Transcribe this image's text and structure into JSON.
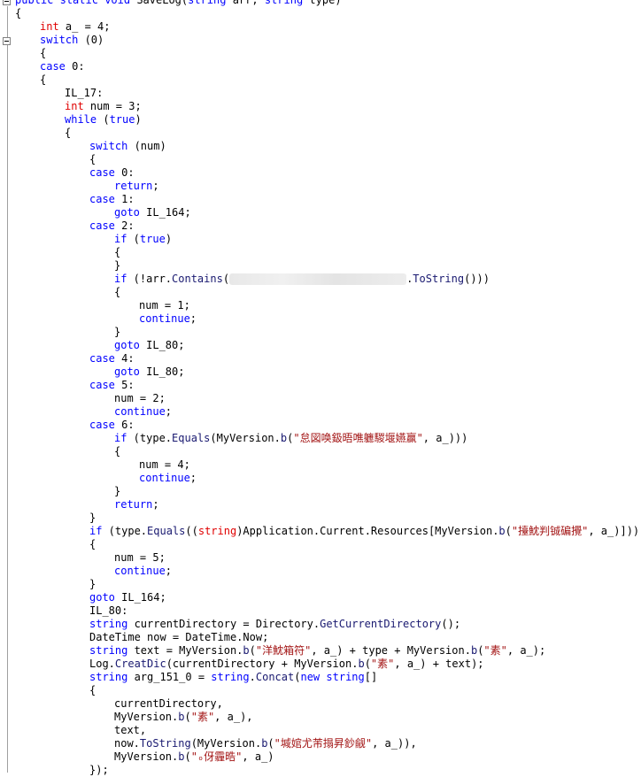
{
  "lines": [
    {
      "indent": 0,
      "parts": [
        [
          "kw",
          "public"
        ],
        [
          "t",
          " "
        ],
        [
          "kw",
          "static"
        ],
        [
          "t",
          " "
        ],
        [
          "kw",
          "void"
        ],
        [
          "t",
          " SaveLog("
        ],
        [
          "kw",
          "string"
        ],
        [
          "t",
          " arr, "
        ],
        [
          "kw",
          "string"
        ],
        [
          "t",
          " type)"
        ]
      ]
    },
    {
      "indent": 0,
      "parts": [
        [
          "t",
          "{"
        ]
      ]
    },
    {
      "indent": 1,
      "parts": [
        [
          "kw2",
          "int"
        ],
        [
          "t",
          " a_ = 4;"
        ]
      ]
    },
    {
      "indent": 1,
      "parts": [
        [
          "kw",
          "switch"
        ],
        [
          "t",
          " (0)"
        ]
      ]
    },
    {
      "indent": 1,
      "parts": [
        [
          "t",
          "{"
        ]
      ]
    },
    {
      "indent": 1,
      "parts": [
        [
          "kw",
          "case"
        ],
        [
          "t",
          " 0:"
        ]
      ]
    },
    {
      "indent": 1,
      "parts": [
        [
          "t",
          "{"
        ]
      ]
    },
    {
      "indent": 2,
      "parts": [
        [
          "t",
          "IL_17:"
        ]
      ]
    },
    {
      "indent": 2,
      "parts": [
        [
          "kw2",
          "int"
        ],
        [
          "t",
          " num = 3;"
        ]
      ]
    },
    {
      "indent": 2,
      "parts": [
        [
          "kw",
          "while"
        ],
        [
          "t",
          " ("
        ],
        [
          "bool",
          "true"
        ],
        [
          "t",
          ")"
        ]
      ]
    },
    {
      "indent": 2,
      "parts": [
        [
          "t",
          "{"
        ]
      ]
    },
    {
      "indent": 3,
      "parts": [
        [
          "kw",
          "switch"
        ],
        [
          "t",
          " (num)"
        ]
      ]
    },
    {
      "indent": 3,
      "parts": [
        [
          "t",
          "{"
        ]
      ]
    },
    {
      "indent": 3,
      "parts": [
        [
          "kw",
          "case"
        ],
        [
          "t",
          " 0:"
        ]
      ]
    },
    {
      "indent": 4,
      "parts": [
        [
          "kw",
          "return"
        ],
        [
          "t",
          ";"
        ]
      ]
    },
    {
      "indent": 3,
      "parts": [
        [
          "kw",
          "case"
        ],
        [
          "t",
          " 1:"
        ]
      ]
    },
    {
      "indent": 4,
      "parts": [
        [
          "kw",
          "goto"
        ],
        [
          "t",
          " IL_164;"
        ]
      ]
    },
    {
      "indent": 3,
      "parts": [
        [
          "kw",
          "case"
        ],
        [
          "t",
          " 2:"
        ]
      ]
    },
    {
      "indent": 4,
      "parts": [
        [
          "kw",
          "if"
        ],
        [
          "t",
          " ("
        ],
        [
          "bool",
          "true"
        ],
        [
          "t",
          ")"
        ]
      ]
    },
    {
      "indent": 4,
      "parts": [
        [
          "t",
          "{"
        ]
      ]
    },
    {
      "indent": 4,
      "parts": [
        [
          "t",
          "}"
        ]
      ]
    },
    {
      "indent": 4,
      "parts": [
        [
          "kw",
          "if"
        ],
        [
          "t",
          " (!arr."
        ],
        [
          "method",
          "Contains"
        ],
        [
          "t",
          "("
        ],
        [
          "blur",
          ""
        ],
        [
          "t",
          "."
        ],
        [
          "method",
          "ToString"
        ],
        [
          "t",
          "()))"
        ]
      ]
    },
    {
      "indent": 4,
      "parts": [
        [
          "t",
          "{"
        ]
      ]
    },
    {
      "indent": 5,
      "parts": [
        [
          "t",
          "num = 1;"
        ]
      ]
    },
    {
      "indent": 5,
      "parts": [
        [
          "kw",
          "continue"
        ],
        [
          "t",
          ";"
        ]
      ]
    },
    {
      "indent": 4,
      "parts": [
        [
          "t",
          "}"
        ]
      ]
    },
    {
      "indent": 4,
      "parts": [
        [
          "kw",
          "goto"
        ],
        [
          "t",
          " IL_80;"
        ]
      ]
    },
    {
      "indent": 3,
      "parts": [
        [
          "kw",
          "case"
        ],
        [
          "t",
          " 4:"
        ]
      ]
    },
    {
      "indent": 4,
      "parts": [
        [
          "kw",
          "goto"
        ],
        [
          "t",
          " IL_80;"
        ]
      ]
    },
    {
      "indent": 3,
      "parts": [
        [
          "kw",
          "case"
        ],
        [
          "t",
          " 5:"
        ]
      ]
    },
    {
      "indent": 4,
      "parts": [
        [
          "t",
          "num = 2;"
        ]
      ]
    },
    {
      "indent": 4,
      "parts": [
        [
          "kw",
          "continue"
        ],
        [
          "t",
          ";"
        ]
      ]
    },
    {
      "indent": 3,
      "parts": [
        [
          "kw",
          "case"
        ],
        [
          "t",
          " 6:"
        ]
      ]
    },
    {
      "indent": 4,
      "parts": [
        [
          "kw",
          "if"
        ],
        [
          "t",
          " (type."
        ],
        [
          "method",
          "Equals"
        ],
        [
          "t",
          "(MyVersion."
        ],
        [
          "method",
          "b"
        ],
        [
          "t",
          "("
        ],
        [
          "str",
          "\"怠図唤鈒晤噍軈騣堰嬿赢\""
        ],
        [
          "t",
          ", a_)))"
        ]
      ]
    },
    {
      "indent": 4,
      "parts": [
        [
          "t",
          "{"
        ]
      ]
    },
    {
      "indent": 5,
      "parts": [
        [
          "t",
          "num = 4;"
        ]
      ]
    },
    {
      "indent": 5,
      "parts": [
        [
          "kw",
          "continue"
        ],
        [
          "t",
          ";"
        ]
      ]
    },
    {
      "indent": 4,
      "parts": [
        [
          "t",
          "}"
        ]
      ]
    },
    {
      "indent": 4,
      "parts": [
        [
          "kw",
          "return"
        ],
        [
          "t",
          ";"
        ]
      ]
    },
    {
      "indent": 3,
      "parts": [
        [
          "t",
          "}"
        ]
      ]
    },
    {
      "indent": 3,
      "parts": [
        [
          "kw",
          "if"
        ],
        [
          "t",
          " (type."
        ],
        [
          "method",
          "Equals"
        ],
        [
          "t",
          "(("
        ],
        [
          "kw2",
          "string"
        ],
        [
          "t",
          ")Application.Current.Resources[MyVersion."
        ],
        [
          "method",
          "b"
        ],
        [
          "t",
          "("
        ],
        [
          "str",
          "\"擡魫判铖碥攪\""
        ],
        [
          "t",
          ", a_)]))"
        ]
      ]
    },
    {
      "indent": 3,
      "parts": [
        [
          "t",
          "{"
        ]
      ]
    },
    {
      "indent": 4,
      "parts": [
        [
          "t",
          "num = 5;"
        ]
      ]
    },
    {
      "indent": 4,
      "parts": [
        [
          "kw",
          "continue"
        ],
        [
          "t",
          ";"
        ]
      ]
    },
    {
      "indent": 3,
      "parts": [
        [
          "t",
          "}"
        ]
      ]
    },
    {
      "indent": 3,
      "parts": [
        [
          "kw",
          "goto"
        ],
        [
          "t",
          " IL_164;"
        ]
      ]
    },
    {
      "indent": 3,
      "parts": [
        [
          "t",
          "IL_80:"
        ]
      ]
    },
    {
      "indent": 3,
      "parts": [
        [
          "kw",
          "string"
        ],
        [
          "t",
          " currentDirectory = Directory."
        ],
        [
          "method",
          "GetCurrentDirectory"
        ],
        [
          "t",
          "();"
        ]
      ]
    },
    {
      "indent": 3,
      "parts": [
        [
          "t",
          "DateTime now = DateTime.Now;"
        ]
      ]
    },
    {
      "indent": 3,
      "parts": [
        [
          "kw",
          "string"
        ],
        [
          "t",
          " text = MyVersion."
        ],
        [
          "method",
          "b"
        ],
        [
          "t",
          "("
        ],
        [
          "str",
          "\"洋魫箱符\""
        ],
        [
          "t",
          ", a_) + type + MyVersion."
        ],
        [
          "method",
          "b"
        ],
        [
          "t",
          "("
        ],
        [
          "str",
          "\"素\""
        ],
        [
          "t",
          ", a_);"
        ]
      ]
    },
    {
      "indent": 3,
      "parts": [
        [
          "t",
          "Log."
        ],
        [
          "method",
          "CreatDic"
        ],
        [
          "t",
          "(currentDirectory + MyVersion."
        ],
        [
          "method",
          "b"
        ],
        [
          "t",
          "("
        ],
        [
          "str",
          "\"素\""
        ],
        [
          "t",
          ", a_) + text);"
        ]
      ]
    },
    {
      "indent": 3,
      "parts": [
        [
          "kw",
          "string"
        ],
        [
          "t",
          " arg_151_0 = "
        ],
        [
          "kw",
          "string"
        ],
        [
          "t",
          "."
        ],
        [
          "method",
          "Concat"
        ],
        [
          "t",
          "("
        ],
        [
          "kw",
          "new"
        ],
        [
          "t",
          " "
        ],
        [
          "kw",
          "string"
        ],
        [
          "t",
          "[]"
        ]
      ]
    },
    {
      "indent": 3,
      "parts": [
        [
          "t",
          "{"
        ]
      ]
    },
    {
      "indent": 4,
      "parts": [
        [
          "t",
          "currentDirectory,"
        ]
      ]
    },
    {
      "indent": 4,
      "parts": [
        [
          "t",
          "MyVersion."
        ],
        [
          "method",
          "b"
        ],
        [
          "t",
          "("
        ],
        [
          "str",
          "\"素\""
        ],
        [
          "t",
          ", a_),"
        ]
      ]
    },
    {
      "indent": 4,
      "parts": [
        [
          "t",
          "text,"
        ]
      ]
    },
    {
      "indent": 4,
      "parts": [
        [
          "t",
          "now."
        ],
        [
          "method",
          "ToString"
        ],
        [
          "t",
          "(MyVersion."
        ],
        [
          "method",
          "b"
        ],
        [
          "t",
          "("
        ],
        [
          "str",
          "\"堿婠尤芾搨昇鈔觎\""
        ],
        [
          "t",
          ", a_)),"
        ]
      ]
    },
    {
      "indent": 4,
      "parts": [
        [
          "t",
          "MyVersion."
        ],
        [
          "method",
          "b"
        ],
        [
          "t",
          "("
        ],
        [
          "str",
          "\"ₒ伢霾晧\""
        ],
        [
          "t",
          ", a_)"
        ]
      ]
    },
    {
      "indent": 3,
      "parts": [
        [
          "t",
          "});"
        ]
      ]
    }
  ],
  "colors": {
    "keyword": "#0000ff",
    "int_keyword": "#e00000",
    "string": "#a31515",
    "method": "#191970",
    "text": "#000000"
  }
}
